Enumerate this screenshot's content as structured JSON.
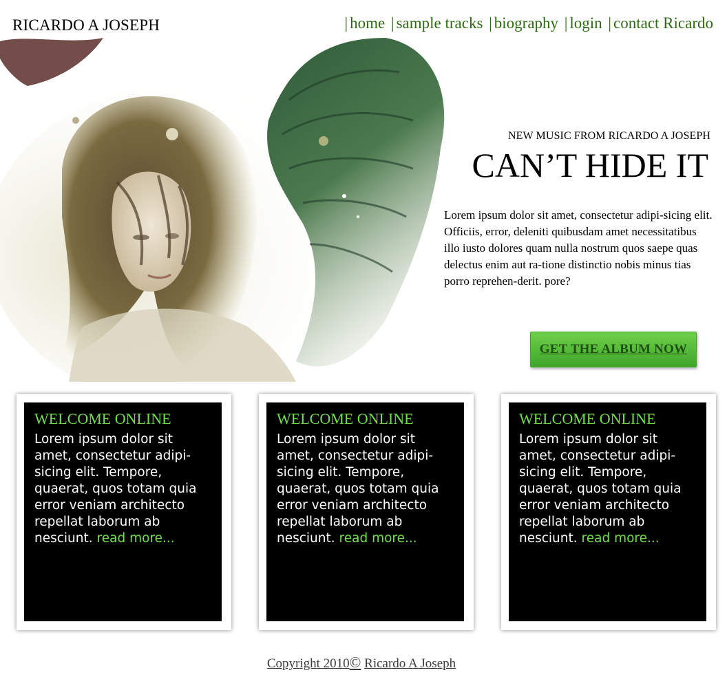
{
  "header": {
    "site_title": "RICARDO A JOSEPH",
    "separator": "|",
    "nav": [
      "home",
      "sample tracks",
      "biography",
      "login",
      "contact Ricardo"
    ]
  },
  "hero": {
    "kicker": "NEW MUSIC FROM RICARDO A JOSEPH",
    "headline": "CAN’T HIDE IT",
    "intro": "Lorem ipsum dolor sit amet, consectetur adipi-sicing elit. Officiis, error, deleniti quibusdam amet necessitatibus illo iusto dolores quam nulla nostrum quos saepe quas delectus enim aut ra-tione distinctio nobis minus tias porro reprehen-derit. pore?",
    "cta_label": "GET  THE ALBUM NOW"
  },
  "cards": [
    {
      "title": "WELCOME ONLINE",
      "body": "Lorem ipsum dolor sit amet, consectetur adipi-sicing elit. Tempore, quaerat, quos totam quia error veniam architecto repellat laborum ab nesciunt. ",
      "link": "read more..."
    },
    {
      "title": "WELCOME ONLINE",
      "body": "Lorem ipsum dolor sit amet, consectetur adipi-sicing elit. Tempore, quaerat, quos totam quia error veniam architecto repellat laborum ab nesciunt. ",
      "link": "read more..."
    },
    {
      "title": "WELCOME ONLINE",
      "body": "Lorem ipsum dolor sit amet, consectetur adipi-sicing elit. Tempore, quaerat, quos totam quia error veniam architecto repellat laborum ab nesciunt. ",
      "link": "read more..."
    }
  ],
  "footer": {
    "copyright_prefix": "Copyright 2010",
    "copyright_symbol": "©",
    "copyright_owner": "Ricardo A Joseph"
  },
  "colors": {
    "nav_green": "#2d6a12",
    "accent_green": "#6fe14a",
    "button_green": "#4fb535",
    "card_bg": "#000000"
  },
  "icons": {
    "copyright": "copyright-icon"
  }
}
